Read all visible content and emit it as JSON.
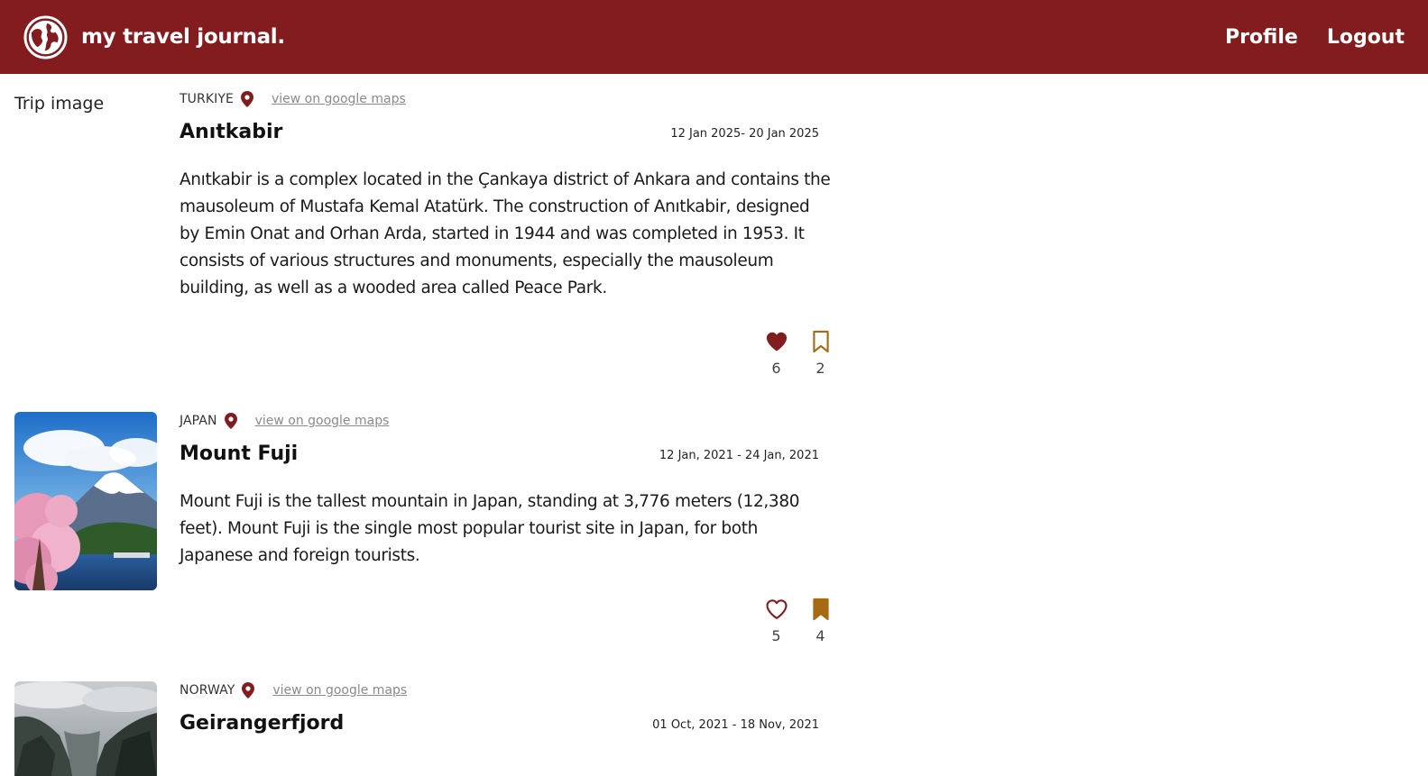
{
  "header": {
    "brand_title": "my travel journal.",
    "nav": {
      "profile": "Profile",
      "logout": "Logout"
    }
  },
  "colors": {
    "brand": "#821c1e",
    "bookmark": "#a56a12"
  },
  "trips": [
    {
      "image_alt": "Trip image",
      "image_broken": true,
      "country": "TURKIYE",
      "maps_link": "view on google maps",
      "title": "Anıtkabir",
      "dates": "12 Jan 2025- 20 Jan 2025",
      "description": "Anıtkabir is a complex located in the Çankaya district of Ankara and contains the mausoleum of Mustafa Kemal Atatürk. The construction of Anıtkabir, designed by Emin Onat and Orhan Arda, started in 1944 and was completed in 1953. It consists of various structures and monuments, especially the mausoleum building, as well as a wooded area called Peace Park.",
      "likes": "6",
      "liked": true,
      "bookmarks": "2",
      "bookmarked": false
    },
    {
      "image_alt": "Trip image",
      "image_broken": false,
      "country": "JAPAN",
      "maps_link": "view on google maps",
      "title": "Mount Fuji",
      "dates": "12 Jan, 2021 - 24 Jan, 2021",
      "description": "Mount Fuji is the tallest mountain in Japan, standing at 3,776 meters (12,380 feet). Mount Fuji is the single most popular tourist site in Japan, for both Japanese and foreign tourists.",
      "likes": "5",
      "liked": false,
      "bookmarks": "4",
      "bookmarked": true
    },
    {
      "image_alt": "Trip image",
      "image_broken": false,
      "country": "NORWAY",
      "maps_link": "view on google maps",
      "title": "Geirangerfjord",
      "dates": "01 Oct, 2021 - 18 Nov, 2021"
    }
  ]
}
